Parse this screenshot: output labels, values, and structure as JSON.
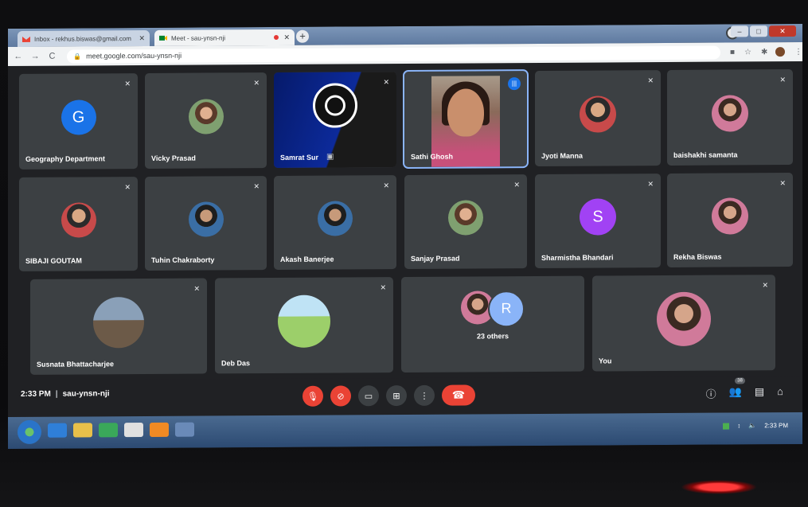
{
  "browser": {
    "tabs": [
      {
        "label": "Inbox - rekhus.biswas@gmail.com",
        "icon": "gmail-icon"
      },
      {
        "label": "Meet - sau-ynsn-nji",
        "icon": "meet-icon"
      }
    ],
    "url": "meet.google.com/sau-ynsn-nji"
  },
  "participants": [
    {
      "name": "Geography Department",
      "initial": "G",
      "color": "#1a73e8"
    },
    {
      "name": "Vicky Prasad"
    },
    {
      "name": "Samrat Sur"
    },
    {
      "name": "Sathi Ghosh"
    },
    {
      "name": "Jyoti Manna"
    },
    {
      "name": "baishakhi samanta"
    },
    {
      "name": "SIBAJI GOUTAM"
    },
    {
      "name": "Tuhin Chakraborty"
    },
    {
      "name": "Akash Banerjee"
    },
    {
      "name": "Sanjay Prasad"
    },
    {
      "name": "Sharmistha Bhandari",
      "initial": "S",
      "color": "#a142f4"
    },
    {
      "name": "Rekha Biswas"
    },
    {
      "name": "Susnata Bhattacharjee"
    },
    {
      "name": "Deb Das"
    },
    {
      "name": "You"
    }
  ],
  "others": {
    "label": "23 others",
    "initial": "R"
  },
  "meeting": {
    "time": "2:33 PM",
    "code": "sau-ynsn-nji",
    "people_count": "38"
  },
  "taskbar": {
    "clock": "2:33 PM"
  }
}
